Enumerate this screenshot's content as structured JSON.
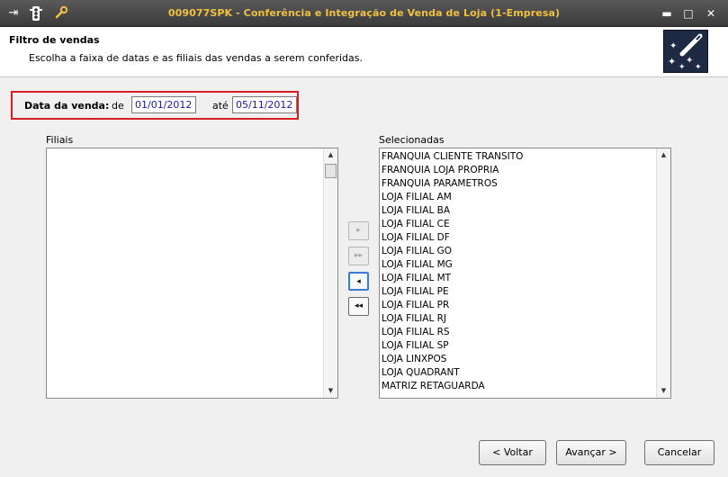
{
  "window": {
    "title": "009077SPK - Conferência e Integração de Venda de Loja (1-Empresa)",
    "icons": [
      "exit-icon",
      "traffic-light-icon",
      "wrench-icon"
    ],
    "controls": {
      "minimize": "▬",
      "maximize": "□",
      "close": "✕"
    }
  },
  "header": {
    "title": "Filtro de vendas",
    "subtitle": "Escolha a faixa de datas e as filiais das vendas a serem conferidas.",
    "logo_icon": "magic-wand-stars-icon"
  },
  "date_filter": {
    "label": "Data da venda:",
    "from_label": "de",
    "from_value": "01/01/2012",
    "to_label": "até",
    "to_value": "05/11/2012"
  },
  "filiais": {
    "label": "Filiais",
    "items": []
  },
  "selecionadas": {
    "label": "Selecionadas",
    "items": [
      "FRANQUIA CLIENTE TRANSITO",
      "FRANQUIA LOJA PROPRIA",
      "FRANQUIA PARAMETROS",
      "LOJA FILIAL AM",
      "LOJA FILIAL BA",
      "LOJA FILIAL CE",
      "LOJA FILIAL DF",
      "LOJA FILIAL GO",
      "LOJA FILIAL MG",
      "LOJA FILIAL MT",
      "LOJA FILIAL PE",
      "LOJA FILIAL PR",
      "LOJA FILIAL RJ",
      "LOJA FILIAL RS",
      "LOJA FILIAL SP",
      "LOJA LINXPOS",
      "LOJA QUADRANT",
      "MATRIZ RETAGUARDA"
    ]
  },
  "transfer_buttons": {
    "add_one": "▸",
    "add_all": "▸▸",
    "remove_one": "◂",
    "remove_all": "◂◂"
  },
  "footer": {
    "back_label": "< Voltar",
    "next_label": "Avançar >",
    "cancel_label": "Cancelar"
  }
}
